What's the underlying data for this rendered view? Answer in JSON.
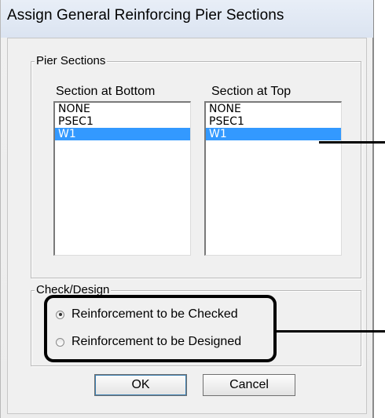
{
  "window": {
    "title": "Assign General Reinforcing Pier Sections"
  },
  "pier_sections": {
    "legend": "Pier Sections",
    "bottom": {
      "label": "Section at Bottom",
      "items": [
        "NONE",
        "PSEC1",
        "W1"
      ],
      "selected": "W1"
    },
    "top": {
      "label": "Section at Top",
      "items": [
        "NONE",
        "PSEC1",
        "W1"
      ],
      "selected": "W1"
    }
  },
  "check_design": {
    "legend": "Check/Design",
    "options": [
      {
        "label": "Reinforcement to be Checked",
        "checked": true
      },
      {
        "label": "Reinforcement to be Designed",
        "checked": false
      }
    ]
  },
  "buttons": {
    "ok": "OK",
    "cancel": "Cancel"
  },
  "colors": {
    "selection": "#3399ff",
    "dialog_bg": "#f0f0f0",
    "annotation": "#000000"
  }
}
